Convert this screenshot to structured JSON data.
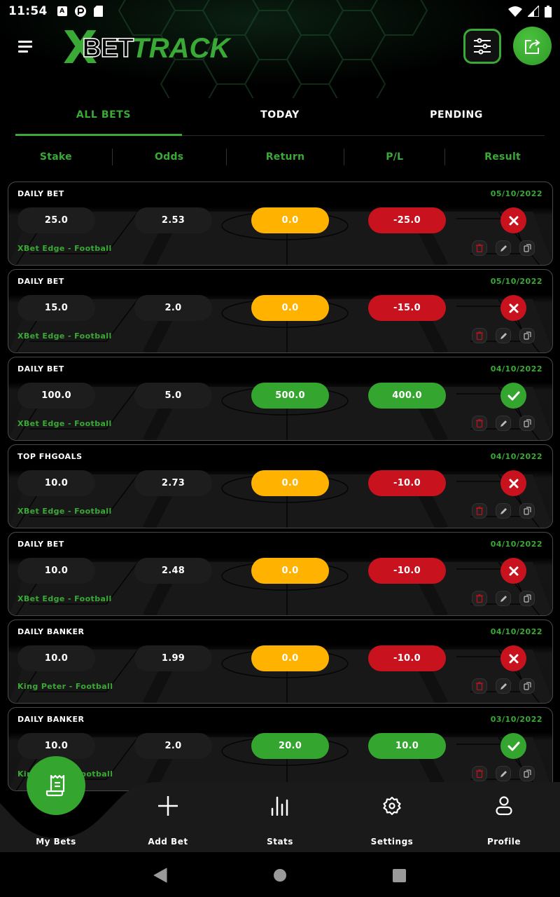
{
  "status_bar": {
    "time": "11:54",
    "left_icons": [
      "a-notification-icon",
      "p-notification-icon",
      "sd-card-icon"
    ],
    "right_icons": [
      "wifi-icon",
      "signal-icon",
      "battery-icon"
    ]
  },
  "header": {
    "logo": {
      "x": "X",
      "bet": "BET",
      "track": "TRACK"
    },
    "menu_icon": "hamburger-menu-icon",
    "filter_icon": "sliders-filter-icon",
    "share_icon": "share-export-icon"
  },
  "tabs": [
    {
      "label": "ALL BETS",
      "active": true
    },
    {
      "label": "TODAY",
      "active": false
    },
    {
      "label": "PENDING",
      "active": false
    }
  ],
  "columns": [
    "Stake",
    "Odds",
    "Return",
    "P/L",
    "Result"
  ],
  "colors": {
    "accent_green": "#3aa935",
    "pending_yellow": "#ffb300",
    "loss_red": "#c8121e",
    "win_green": "#34a52e"
  },
  "bets": [
    {
      "title": "DAILY BET",
      "date": "05/10/2022",
      "stake": "25.0",
      "odds": "2.53",
      "return": "0.0",
      "pl": "-25.0",
      "result": "lost",
      "source": "XBet Edge - Football"
    },
    {
      "title": "DAILY BET",
      "date": "05/10/2022",
      "stake": "15.0",
      "odds": "2.0",
      "return": "0.0",
      "pl": "-15.0",
      "result": "lost",
      "source": "XBet Edge - Football"
    },
    {
      "title": "DAILY BET",
      "date": "04/10/2022",
      "stake": "100.0",
      "odds": "5.0",
      "return": "500.0",
      "pl": "400.0",
      "result": "won",
      "source": "XBet Edge - Football"
    },
    {
      "title": "TOP FHGOALS",
      "date": "04/10/2022",
      "stake": "10.0",
      "odds": "2.73",
      "return": "0.0",
      "pl": "-10.0",
      "result": "lost",
      "source": "XBet Edge - Football"
    },
    {
      "title": "DAILY BET",
      "date": "04/10/2022",
      "stake": "10.0",
      "odds": "2.48",
      "return": "0.0",
      "pl": "-10.0",
      "result": "lost",
      "source": "XBet Edge - Football"
    },
    {
      "title": "DAILY BANKER",
      "date": "04/10/2022",
      "stake": "10.0",
      "odds": "1.99",
      "return": "0.0",
      "pl": "-10.0",
      "result": "lost",
      "source": "King Peter - Football"
    },
    {
      "title": "DAILY BANKER",
      "date": "03/10/2022",
      "stake": "10.0",
      "odds": "2.0",
      "return": "20.0",
      "pl": "10.0",
      "result": "won",
      "source": "King Peter - Football"
    }
  ],
  "card_actions": [
    "delete-icon",
    "edit-icon",
    "copy-icon"
  ],
  "bottom_nav": [
    {
      "label": "My Bets",
      "icon": "receipt-icon",
      "active": true
    },
    {
      "label": "Add Bet",
      "icon": "plus-icon",
      "active": false
    },
    {
      "label": "Stats",
      "icon": "bar-chart-icon",
      "active": false
    },
    {
      "label": "Settings",
      "icon": "gear-icon",
      "active": false
    },
    {
      "label": "Profile",
      "icon": "user-icon",
      "active": false
    }
  ],
  "system_nav": [
    "back-icon",
    "home-icon",
    "recents-icon"
  ]
}
